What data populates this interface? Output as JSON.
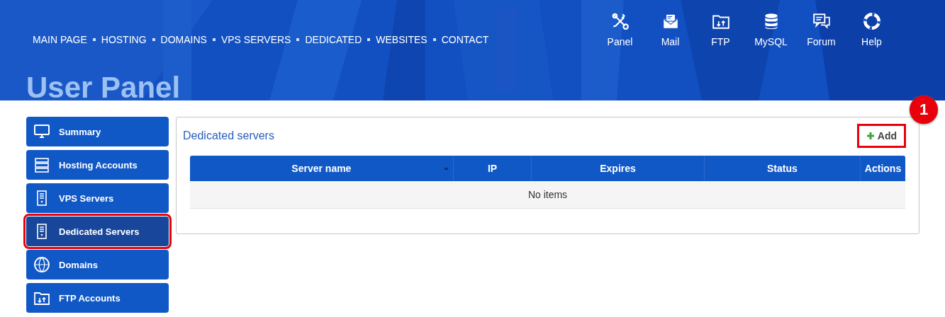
{
  "header": {
    "nav": [
      "MAIN PAGE",
      "HOSTING",
      "DOMAINS",
      "VPS SERVERS",
      "DEDICATED",
      "WEBSITES",
      "CONTACT"
    ],
    "tools": [
      {
        "label": "Panel",
        "kind": "tools"
      },
      {
        "label": "Mail",
        "kind": "mail"
      },
      {
        "label": "FTP",
        "kind": "ftp"
      },
      {
        "label": "MySQL",
        "kind": "database"
      },
      {
        "label": "Forum",
        "kind": "forum"
      },
      {
        "label": "Help",
        "kind": "help"
      }
    ],
    "title": "User Panel"
  },
  "sidebar": {
    "items": [
      {
        "label": "Summary",
        "kind": "monitor",
        "selected": false,
        "highlighted": false
      },
      {
        "label": "Hosting Accounts",
        "kind": "rack",
        "selected": false,
        "highlighted": false
      },
      {
        "label": "VPS Servers",
        "kind": "server",
        "selected": false,
        "highlighted": false
      },
      {
        "label": "Dedicated Servers",
        "kind": "server",
        "selected": true,
        "highlighted": true
      },
      {
        "label": "Domains",
        "kind": "globe",
        "selected": false,
        "highlighted": false
      },
      {
        "label": "FTP Accounts",
        "kind": "ftp",
        "selected": false,
        "highlighted": false
      }
    ]
  },
  "panel": {
    "title": "Dedicated servers",
    "add_button": {
      "label": "Add",
      "highlighted": true
    },
    "table": {
      "columns": [
        {
          "label": "Server name",
          "sorted": true
        },
        {
          "label": "IP",
          "sorted": false
        },
        {
          "label": "Expires",
          "sorted": false
        },
        {
          "label": "Status",
          "sorted": false
        },
        {
          "label": "Actions",
          "sorted": false
        }
      ],
      "empty_text": "No items"
    }
  },
  "annotation": {
    "badge": "1"
  }
}
